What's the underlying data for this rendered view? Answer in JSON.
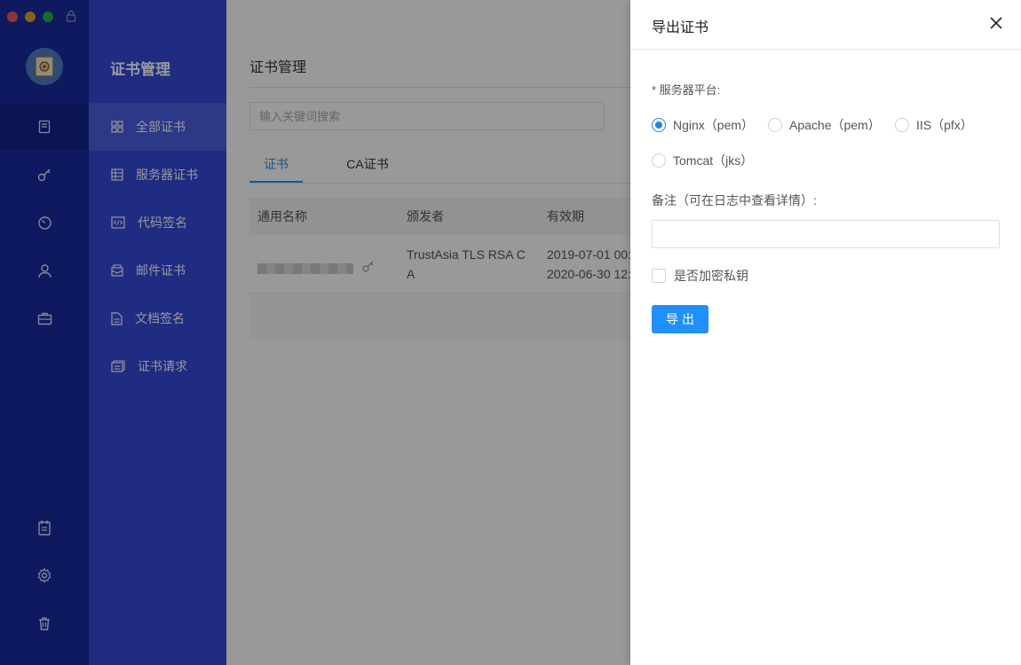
{
  "window": {
    "traffic_lights": [
      "#ee5a52",
      "#e0a31d",
      "#28b33d"
    ]
  },
  "rail": {
    "top_items": [
      "certificate-icon",
      "key-icon",
      "timer-icon",
      "user-icon",
      "briefcase-icon"
    ],
    "bottom_items": [
      "clipboard-icon",
      "gear-icon",
      "trash-icon"
    ]
  },
  "subnav": {
    "title": "证书管理",
    "items": [
      {
        "label": "全部证书",
        "icon": "grid-icon",
        "active": true
      },
      {
        "label": "服务器证书",
        "icon": "server-cert-icon"
      },
      {
        "label": "代码签名",
        "icon": "code-icon"
      },
      {
        "label": "邮件证书",
        "icon": "mail-icon"
      },
      {
        "label": "文档签名",
        "icon": "document-icon"
      },
      {
        "label": "证书请求",
        "icon": "request-icon"
      }
    ]
  },
  "main": {
    "title": "证书管理",
    "search_placeholder": "输入关键词搜索",
    "tabs": [
      "证书",
      "CA证书"
    ],
    "table": {
      "headers": [
        "通用名称",
        "颁发者",
        "有效期"
      ],
      "rows": [
        {
          "issuer_line1": "TrustAsia TLS RSA C",
          "issuer_line2": "A",
          "valid_from": "2019-07-01 00:",
          "valid_to": "2020-06-30 12:"
        }
      ]
    }
  },
  "drawer": {
    "title": "导出证书",
    "platform_label": "* 服务器平台:",
    "platform_options": [
      "Nginx（pem）",
      "Apache（pem）",
      "IIS（pfx）",
      "Tomcat（jks）"
    ],
    "selected_platform": "Nginx（pem）",
    "note_label": "备注（可在日志中查看详情）:",
    "note_value": "",
    "encrypt_label": "是否加密私钥",
    "export_button": "导出"
  },
  "colors": {
    "rail": "#1a2a9e",
    "subnav": "#3648d9",
    "accent": "#1e90ff"
  }
}
